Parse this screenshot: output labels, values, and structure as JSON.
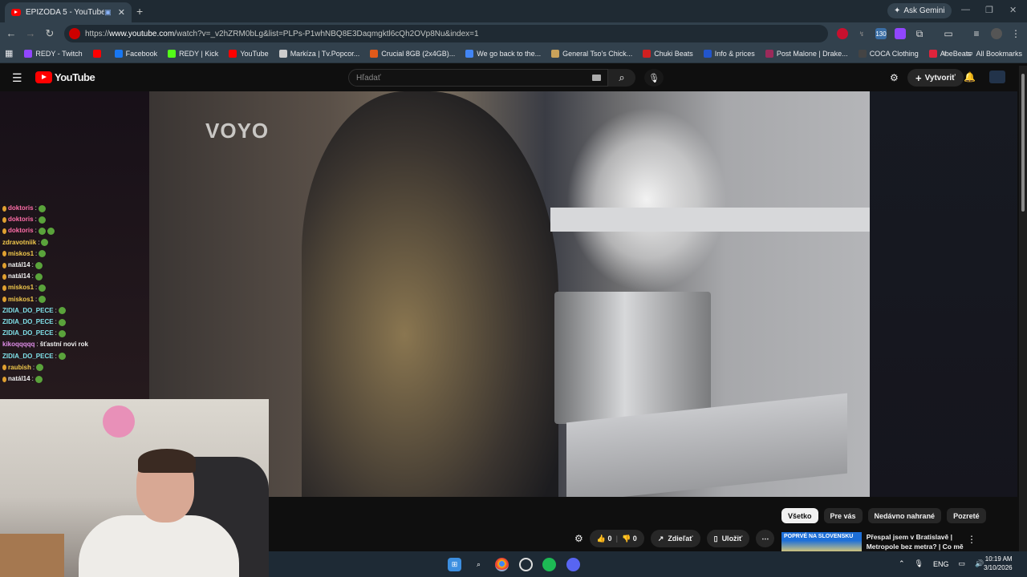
{
  "browser": {
    "tab_title": "EPIZÓDA 5 - YouTube",
    "new_tab_icon": "plus-icon",
    "gemini_label": "Ask Gemini",
    "url_prefix": "https://",
    "url_host": "www.youtube.com",
    "url_path": "/watch?v=_v2hZRM0bLg&list=PLPs-P1whNBQ8E3Daqmgktl6cQh2OVp8Nu&index=1",
    "bookmarks": [
      {
        "label": "REDY - Twitch",
        "color": "#9146ff"
      },
      {
        "label": "",
        "color": "#ff0000"
      },
      {
        "label": "Facebook",
        "color": "#1877f2"
      },
      {
        "label": "REDY | Kick",
        "color": "#53fc18"
      },
      {
        "label": "YouTube",
        "color": "#ff0000"
      },
      {
        "label": "Markíza | Tv.Popcor...",
        "color": "#cccccc"
      },
      {
        "label": "Crucial 8GB (2x4GB)...",
        "color": "#e05a1a"
      },
      {
        "label": "We go back to the...",
        "color": "#4285f4"
      },
      {
        "label": "General Tso's Chick...",
        "color": "#c9a25a"
      },
      {
        "label": "Chuki Beats",
        "color": "#d02020"
      },
      {
        "label": "Info & prices",
        "color": "#2255cc"
      },
      {
        "label": "Post Malone | Drake...",
        "color": "#9b2a5a"
      },
      {
        "label": "COCA Clothing",
        "color": "#444444"
      },
      {
        "label": "AbeBeats",
        "color": "#e0243c"
      }
    ],
    "all_bookmarks": "All Bookmarks"
  },
  "youtube": {
    "logo_text": "YouTube",
    "search_placeholder": "Hľadať",
    "create_label": "Vytvoriť",
    "chips": [
      "Všetko",
      "Pre vás",
      "Nedávno nahrané",
      "Pozreté"
    ],
    "likes": "0",
    "dislikes": "0",
    "share_label": "Zdieľať",
    "save_label": "Uložiť",
    "rec_thumb_text": "POPRVÉ NA SLOVENSKU",
    "rec_title": "Přespal jsem v Bratislavě | Metropole bez metra? | Co mě ..."
  },
  "video": {
    "watermark": "VOYO"
  },
  "chat": [
    {
      "user": "doktoris",
      "color": "#ff6ea8",
      "badge": true,
      "text": "",
      "emotes": 1
    },
    {
      "user": "doktoris",
      "color": "#ff6ea8",
      "badge": true,
      "text": "",
      "emotes": 1
    },
    {
      "user": "doktoris",
      "color": "#ff6ea8",
      "badge": true,
      "text": "",
      "emotes": 2
    },
    {
      "user": "zdravotniik",
      "color": "#f2c94c",
      "badge": false,
      "text": "",
      "emotes": 1
    },
    {
      "user": "miskos1",
      "color": "#f2c94c",
      "badge": true,
      "text": "",
      "emotes": 1
    },
    {
      "user": "natál14",
      "color": "#f1f1f1",
      "badge": true,
      "text": "",
      "emotes": 1
    },
    {
      "user": "natál14",
      "color": "#f1f1f1",
      "badge": true,
      "text": "",
      "emotes": 1
    },
    {
      "user": "miskos1",
      "color": "#f2c94c",
      "badge": true,
      "text": "",
      "emotes": 1
    },
    {
      "user": "miskos1",
      "color": "#f2c94c",
      "badge": true,
      "text": "",
      "emotes": 1
    },
    {
      "user": "ZIDIA_DO_PECE",
      "color": "#7fe0e8",
      "badge": false,
      "text": "",
      "emotes": 1
    },
    {
      "user": "ZIDIA_DO_PECE",
      "color": "#7fe0e8",
      "badge": false,
      "text": "",
      "emotes": 1
    },
    {
      "user": "ZIDIA_DO_PECE",
      "color": "#7fe0e8",
      "badge": false,
      "text": "",
      "emotes": 1
    },
    {
      "user": "kikoqqqqq",
      "color": "#e08ee8",
      "badge": false,
      "text": "šťastní novi rok",
      "emotes": 0
    },
    {
      "user": "ZIDIA_DO_PECE",
      "color": "#7fe0e8",
      "badge": false,
      "text": "",
      "emotes": 1
    },
    {
      "user": "raubish",
      "color": "#f2c94c",
      "badge": true,
      "text": "",
      "emotes": 1
    },
    {
      "user": "natál14",
      "color": "#f1f1f1",
      "badge": true,
      "text": "",
      "emotes": 1
    }
  ],
  "taskbar": {
    "lang": "ENG",
    "time": "10:19 AM",
    "date": "3/10/2026"
  }
}
